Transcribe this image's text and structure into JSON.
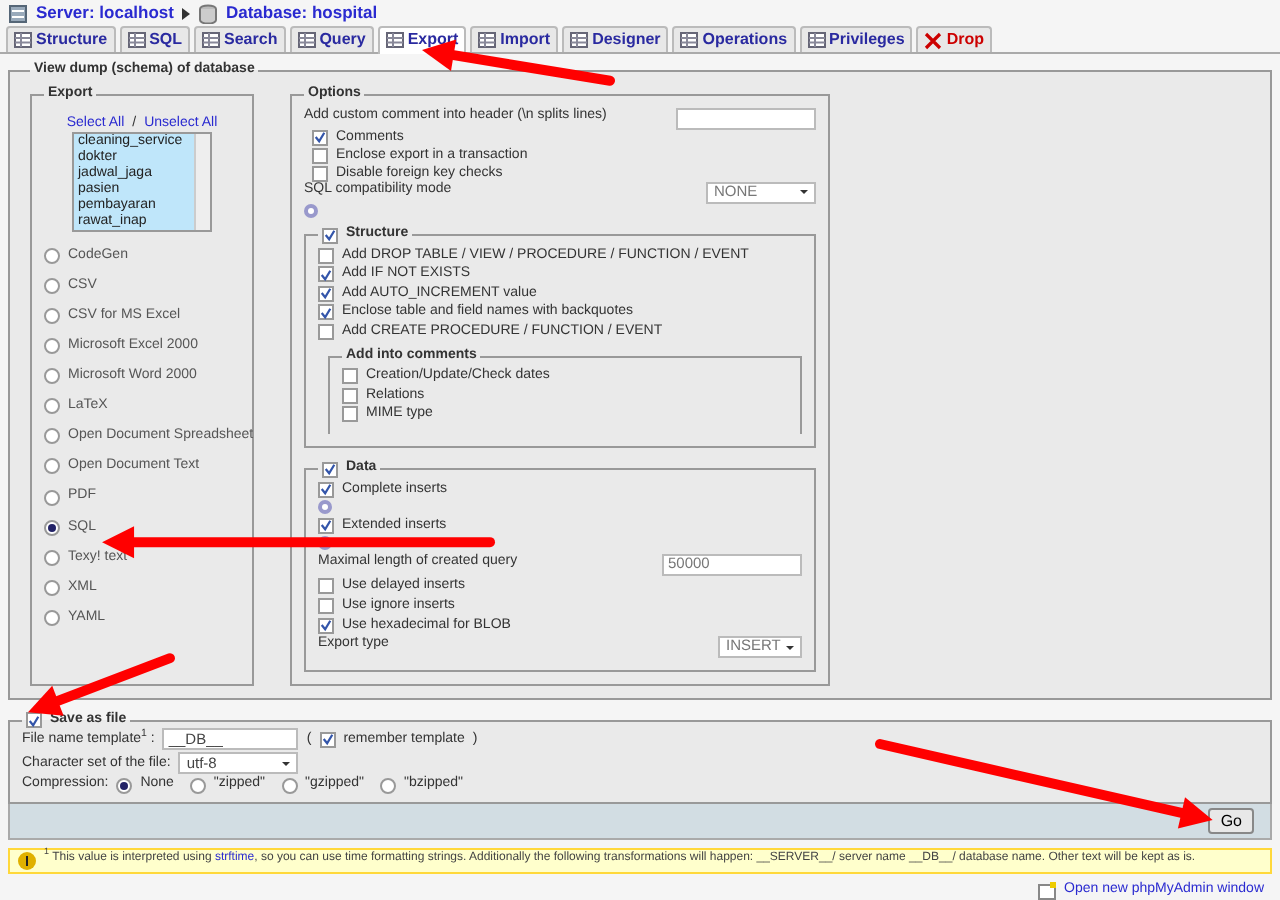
{
  "breadcrumb": [
    {
      "label": "Server: localhost"
    },
    {
      "label": "Database: hospital"
    }
  ],
  "tabs": [
    {
      "label": "Structure",
      "selected": false,
      "kind": "normal"
    },
    {
      "label": "SQL",
      "selected": false,
      "kind": "normal"
    },
    {
      "label": "Search",
      "selected": false,
      "kind": "normal"
    },
    {
      "label": "Query",
      "selected": false,
      "kind": "normal"
    },
    {
      "label": "Export",
      "selected": true,
      "kind": "normal"
    },
    {
      "label": "Import",
      "selected": false,
      "kind": "normal"
    },
    {
      "label": "Designer",
      "selected": false,
      "kind": "normal"
    },
    {
      "label": "Operations",
      "selected": false,
      "kind": "normal"
    },
    {
      "label": "Privileges",
      "selected": false,
      "kind": "normal"
    },
    {
      "label": "Drop",
      "selected": false,
      "kind": "danger"
    }
  ],
  "dump": {
    "legend": "View dump (schema) of database",
    "export": {
      "legend": "Export",
      "select_all": "Select All",
      "separator": "/",
      "unselect_all": "Unselect All",
      "tables": [
        {
          "label": "cleaning_service",
          "selected": true
        },
        {
          "label": "dokter",
          "selected": true
        },
        {
          "label": "jadwal_jaga",
          "selected": true
        },
        {
          "label": "pasien",
          "selected": true
        },
        {
          "label": "pembayaran",
          "selected": true
        },
        {
          "label": "rawat_inap",
          "selected": true
        }
      ],
      "formats": [
        {
          "label": "CodeGen",
          "selected": false
        },
        {
          "label": "CSV",
          "selected": false
        },
        {
          "label": "CSV for MS Excel",
          "selected": false
        },
        {
          "label": "Microsoft Excel 2000",
          "selected": false
        },
        {
          "label": "Microsoft Word 2000",
          "selected": false
        },
        {
          "label": "LaTeX",
          "selected": false
        },
        {
          "label": "Open Document Spreadsheet",
          "selected": false
        },
        {
          "label": "Open Document Text",
          "selected": false
        },
        {
          "label": "PDF",
          "selected": false
        },
        {
          "label": "SQL",
          "selected": true
        },
        {
          "label": "Texy! text",
          "selected": false
        },
        {
          "label": "XML",
          "selected": false
        },
        {
          "label": "YAML",
          "selected": false
        }
      ]
    },
    "options": {
      "legend": "Options",
      "comment_label": "Add custom comment into header (\\n splits lines)",
      "general": [
        {
          "label": "Comments",
          "checked": true
        },
        {
          "label": "Enclose export in a transaction",
          "checked": false
        },
        {
          "label": "Disable foreign key checks",
          "checked": false
        }
      ],
      "compat_label": "SQL compatibility mode",
      "compat_value": "NONE",
      "structure": {
        "label": "Structure",
        "checked": true,
        "items": [
          {
            "label": "Add DROP TABLE / VIEW / PROCEDURE / FUNCTION / EVENT",
            "checked": false
          },
          {
            "label": "Add IF NOT EXISTS",
            "checked": true
          },
          {
            "label": "Add AUTO_INCREMENT value",
            "checked": true
          },
          {
            "label": "Enclose table and field names with backquotes",
            "checked": true
          },
          {
            "label": "Add CREATE PROCEDURE / FUNCTION / EVENT",
            "checked": false
          }
        ],
        "comments_legend": "Add into comments",
        "comments": [
          {
            "label": "Creation/Update/Check dates",
            "checked": false
          },
          {
            "label": "Relations",
            "checked": false
          },
          {
            "label": "MIME type",
            "checked": false
          }
        ]
      },
      "data": {
        "label": "Data",
        "checked": true,
        "items": [
          {
            "kind": "check",
            "label": "Complete inserts",
            "checked": true,
            "help": true
          },
          {
            "kind": "check",
            "label": "Extended inserts",
            "checked": true,
            "help": true
          },
          {
            "kind": "input",
            "label": "Maximal length of created query",
            "value": "50000"
          },
          {
            "kind": "check",
            "label": "Use delayed inserts",
            "checked": false
          },
          {
            "kind": "check",
            "label": "Use ignore inserts",
            "checked": false
          },
          {
            "kind": "check",
            "label": "Use hexadecimal for BLOB",
            "checked": true
          },
          {
            "kind": "select",
            "label": "Export type",
            "value": "INSERT"
          }
        ]
      }
    }
  },
  "save": {
    "label": "Save as file",
    "checked": true,
    "template_label": "File name template$^{1}$ :",
    "template_value": "__DB__",
    "paren_open": "(",
    "remember_label": "remember template",
    "remember_checked": true,
    "paren_close": ")",
    "charset_label": "Character set of the file:",
    "charset_value": "utf-8",
    "compression_label": "Compression:",
    "compression": [
      {
        "label": "None",
        "selected": true
      },
      {
        "label": "\"zipped\"",
        "selected": false
      },
      {
        "label": "\"gzipped\"",
        "selected": false
      },
      {
        "label": "\"bzipped\"",
        "selected": false
      }
    ]
  },
  "go": "Go",
  "footnote": {
    "mark": "1",
    "before": "This value is interpreted using",
    "link": "strftime",
    "after": ", so you can use time formatting strings. Additionally the following transformations will happen: __SERVER__/ server name __DB__/ database name. Other text will be kept as is."
  },
  "new_window": "Open new phpMyAdmin window"
}
